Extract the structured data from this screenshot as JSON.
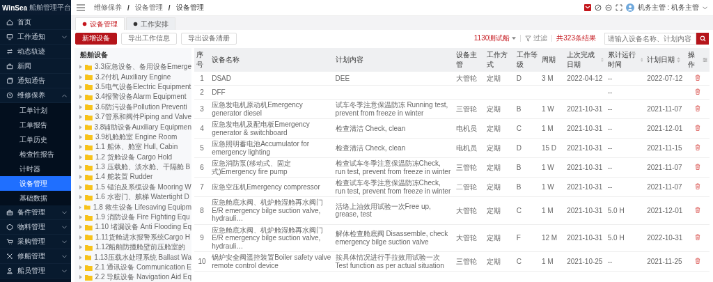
{
  "sidebar": {
    "logo": "WinSea",
    "subtitle": "船舶管理平台",
    "items": [
      {
        "label": "首页",
        "selected": false
      },
      {
        "label": "工作通知",
        "selected": false,
        "expanded": false
      },
      {
        "label": "动态轨迹",
        "selected": false
      },
      {
        "label": "新闻",
        "selected": false
      },
      {
        "label": "通知通告",
        "selected": false
      },
      {
        "label": "维修保养",
        "selected": false,
        "expanded": true,
        "children": [
          {
            "label": "工单计划",
            "selected": false
          },
          {
            "label": "工单报告",
            "selected": false
          },
          {
            "label": "工单历史",
            "selected": false
          },
          {
            "label": "检查性报告",
            "selected": false
          },
          {
            "label": "计时器",
            "selected": false
          },
          {
            "label": "设备管理",
            "selected": true
          },
          {
            "label": "基础数据",
            "selected": false
          }
        ]
      },
      {
        "label": "备件管理",
        "selected": false,
        "expanded": false
      },
      {
        "label": "物料管理",
        "selected": false,
        "expanded": false
      },
      {
        "label": "采购管理",
        "selected": false,
        "expanded": false
      },
      {
        "label": "修船管理",
        "selected": false,
        "expanded": false
      },
      {
        "label": "船员管理",
        "selected": false,
        "expanded": false
      }
    ]
  },
  "header": {
    "breadcrumb": [
      {
        "label": "维修保养"
      },
      {
        "separator": "/",
        "label": "设备管理"
      },
      {
        "separator": "/",
        "label": "设备管理"
      }
    ],
    "user": "机务主管 : 机务主管"
  },
  "tabs": [
    {
      "label": "设备管理",
      "selected": true
    },
    {
      "label": "工作安排",
      "selected": false
    }
  ],
  "toolbar": {
    "buttons": [
      {
        "label": "新增设备",
        "kind": "primary"
      },
      {
        "label": "导出工作信息",
        "kind": "default"
      },
      {
        "label": "导出设备清册",
        "kind": "default"
      }
    ],
    "ship": "1130测试船",
    "filter": "过滤",
    "result_count": "共323条结果",
    "search": {
      "placeholder": "请输入设备名称、计划内容"
    }
  },
  "tree": {
    "title": "船舶设备",
    "items": [
      {
        "label": "3.3应急设备、备用设备Emerge",
        "expanded": false
      },
      {
        "label": "3.2付机 Auxiliary Engine",
        "expanded": false
      },
      {
        "label": "3.5电气设备Electric Equipment",
        "expanded": false
      },
      {
        "label": "3.4报警设备Alarm Equipment",
        "expanded": false
      },
      {
        "label": "3.6防污设备Pollution Preventi",
        "expanded": false
      },
      {
        "label": "3.7管系和阀件Piping and Valve",
        "expanded": false
      },
      {
        "label": "3.8辅助设备Auxiliary Equipmen",
        "expanded": false
      },
      {
        "label": "3.9机舱舱室 Engine Room",
        "expanded": false
      },
      {
        "label": "1.1 船体、舱室 Hull, Cabin",
        "expanded": false
      },
      {
        "label": "1.2 货舱设备 Cargo Hold",
        "expanded": false
      },
      {
        "label": "1.3 压载舱、淡水舱、干隔舱 B",
        "expanded": false
      },
      {
        "label": "1.4 舵装置 Rudder",
        "expanded": false
      },
      {
        "label": "1.5 锚泊及系缆设备 Mooring W",
        "expanded": false
      },
      {
        "label": "1.6 水密门、舷梯 Watertight D",
        "expanded": false
      },
      {
        "label": "1.8 救生设备 Lifesaving Equipm",
        "expanded": false
      },
      {
        "label": "1.9 消防设备 Fire Fighting Equ",
        "expanded": false
      },
      {
        "label": "1.10 堵漏设备 Anti Flooding Eq",
        "expanded": false
      },
      {
        "label": "1.11货舱进水报警系统Cargo H",
        "expanded": false
      },
      {
        "label": "1.12船舶防撞舱壁前压舱室的",
        "expanded": false
      },
      {
        "label": "1.13压载水处理系统 Ballast Wa",
        "expanded": false
      },
      {
        "label": "2.1 通讯设备 Communication E",
        "expanded": false
      },
      {
        "label": "2.2 导航设备 Navigation Aid Eq",
        "expanded": false
      }
    ]
  },
  "table": {
    "columns": [
      {
        "label": "序号",
        "sortable": false
      },
      {
        "label": "设备名称",
        "sortable": false
      },
      {
        "label": "计划内容",
        "sortable": false
      },
      {
        "label": "设备主管",
        "sortable": false
      },
      {
        "label": "工作方式",
        "sortable": false
      },
      {
        "label": "工作等级",
        "sortable": false
      },
      {
        "label": "周期",
        "sortable": false
      },
      {
        "label": "上次完成日期",
        "sortable": true
      },
      {
        "label": "累计运行时间",
        "sortable": true
      },
      {
        "label": "计划日期",
        "sortable": true
      },
      {
        "label": "操作",
        "sortable": false
      }
    ],
    "rows": [
      {
        "no": "1",
        "name": "DSAD",
        "plan": "DEE",
        "manager": "大管轮",
        "mode": "定期",
        "grade": "D",
        "cycle": "3 M",
        "last_done": "2022-04-12",
        "runtime": "--",
        "plan_date": "2022-07-12"
      },
      {
        "no": "2",
        "name": "DFF",
        "runtime": "--"
      },
      {
        "no": "3",
        "name": "应急发电机原动机Emergency generator diesel",
        "plan": "试车冬季注意保温防冻 Running test, prevent from freeze in winter",
        "manager": "三管轮",
        "mode": "定期",
        "grade": "B",
        "cycle": "1 W",
        "last_done": "2021-10-31",
        "runtime": "--",
        "plan_date": "2021-11-07"
      },
      {
        "no": "4",
        "name": "应急发电机及配电板Emergency generator & switchboard",
        "plan": "检查清洁 Check, clean",
        "manager": "电机员",
        "mode": "定期",
        "grade": "C",
        "cycle": "1 M",
        "last_done": "2021-10-31",
        "runtime": "--",
        "plan_date": "2021-12-01"
      },
      {
        "no": "5",
        "name": "应急照明蓄电池Accumulator for emergency lighting",
        "plan": "检查清洁 Check, clean",
        "manager": "电机员",
        "mode": "定期",
        "grade": "D",
        "cycle": "15 D",
        "last_done": "2021-10-31",
        "runtime": "--",
        "plan_date": "2021-11-15"
      },
      {
        "no": "6",
        "name": "应急消防泵(移动式、固定式)Emergency fire pump",
        "plan": "检查试车冬季注意保温防冻Check, run test, prevent from freeze in winter",
        "manager": "三管轮",
        "mode": "定期",
        "grade": "B",
        "cycle": "1 W",
        "last_done": "2021-10-31",
        "runtime": "--",
        "plan_date": "2021-11-07"
      },
      {
        "no": "7",
        "name": "应急空压机Emergency compressor",
        "plan": "检查试车冬季注意保温防冻Check, run test, prevent from freeze in winter",
        "manager": "二管轮",
        "mode": "定期",
        "grade": "B",
        "cycle": "1 W",
        "last_done": "2021-10-31",
        "runtime": "--",
        "plan_date": "2021-11-07"
      },
      {
        "no": "8",
        "name": "应急舱底水阀、机炉舱湿舱再水阀门 E/R emergency bilge suction valve, hydrauli…",
        "plan": "活络上油效用试验一次Free up, grease, test",
        "manager": "大管轮",
        "mode": "定期",
        "grade": "C",
        "cycle": "1 M",
        "last_done": "2021-10-31",
        "runtime": "5.0 H",
        "plan_date": "2021-12-01"
      },
      {
        "no": "9",
        "name": "应急舱底水阀、机炉舱湿舱再水阀门 E/R emergency bilge suction valve, hydrauli…",
        "plan": "解体检查舱底阀 Disassemble, check emergency bilge suction valve",
        "manager": "大管轮",
        "mode": "定期",
        "grade": "F",
        "cycle": "12 M",
        "last_done": "2021-10-31",
        "runtime": "5.0 H",
        "plan_date": "2022-10-31"
      },
      {
        "no": "10",
        "name": "锅炉安全阀遥控装置Boiler safety valve remote control device",
        "plan": "按具体情况进行手拉效用试验一次Test function as per actual situation",
        "manager": "三管轮",
        "mode": "定期",
        "grade": "C",
        "cycle": "1 M",
        "last_done": "2021-10-25",
        "runtime": "--",
        "plan_date": "2021-11-25"
      }
    ]
  }
}
